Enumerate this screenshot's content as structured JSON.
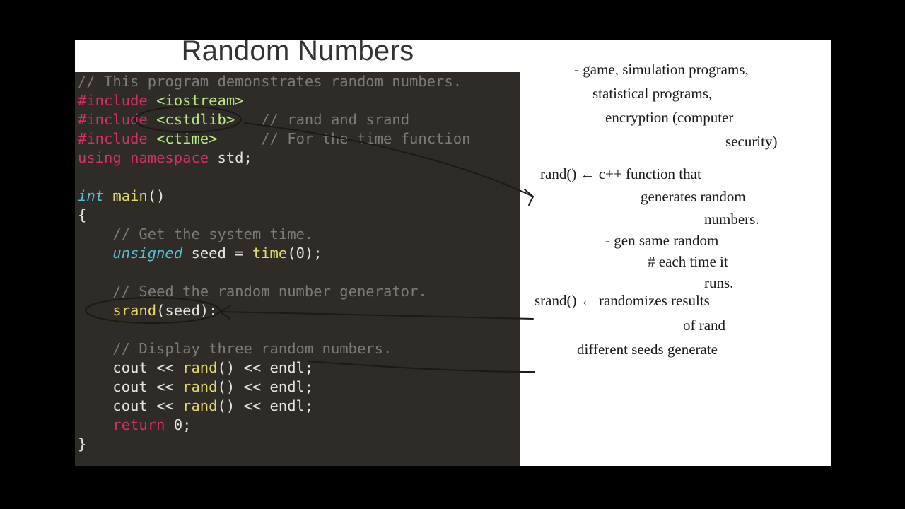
{
  "slide": {
    "title": "Random Numbers"
  },
  "code": {
    "l1_comment": "// This program demonstrates random numbers.",
    "l2_pp": "#include",
    "l2_inc": "<iostream>",
    "l3_pp": "#include",
    "l3_inc": "<cstdlib>",
    "l3_comment": "// rand and srand",
    "l4_pp": "#include",
    "l4_inc": "<ctime>",
    "l4_comment": "// For the time function",
    "l5_using": "using",
    "l5_ns": "namespace",
    "l5_std": "std;",
    "l7_int": "int",
    "l7_main": "main",
    "l7_rest": "()",
    "l8_brace": "{",
    "l9_comment": "// Get the system time.",
    "l10_unsigned": "unsigned",
    "l10_seed": " seed = ",
    "l10_time": "time",
    "l10_rest": "(0);",
    "l12_comment": "// Seed the random number generator.",
    "l13_srand": "srand",
    "l13_rest": "(seed);",
    "l15_comment": "// Display three random numbers.",
    "l16_a": "cout << ",
    "l16_rand": "rand",
    "l16_b": "() << endl;",
    "l17_a": "cout << ",
    "l17_rand": "rand",
    "l17_b": "() << endl;",
    "l18_a": "cout << ",
    "l18_rand": "rand",
    "l18_b": "() << endl;",
    "l19_return": "return",
    "l19_rest": " 0;",
    "l20_brace": "}"
  },
  "notes": {
    "n1": "- game, simulation programs,",
    "n2": "statistical programs,",
    "n3": "encryption (computer",
    "n4": "security)",
    "n5": "rand() ← c++ function that",
    "n6": "generates random",
    "n7": "numbers.",
    "n8": "- gen same random",
    "n9": "# each time it",
    "n10": "runs.",
    "n11": "srand() ← randomizes results",
    "n12": "of rand",
    "n13": "different seeds generate"
  }
}
